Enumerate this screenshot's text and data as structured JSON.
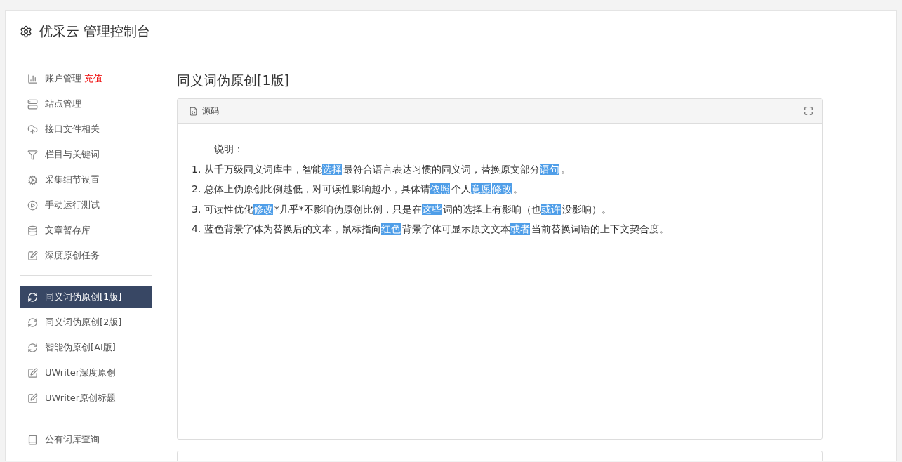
{
  "header": {
    "title": "优采云 管理控制台"
  },
  "sidebar": {
    "groups": [
      {
        "items": [
          {
            "label": "账户管理",
            "badge": "充值",
            "selected": false
          },
          {
            "label": "站点管理",
            "selected": false
          },
          {
            "label": "接口文件相关",
            "selected": false
          },
          {
            "label": "栏目与关键词",
            "selected": false
          },
          {
            "label": "采集细节设置",
            "selected": false
          },
          {
            "label": "手动运行测试",
            "selected": false
          },
          {
            "label": "文章暂存库",
            "selected": false
          },
          {
            "label": "深度原创任务",
            "selected": false
          }
        ]
      },
      {
        "items": [
          {
            "label": "同义词伪原创[1版]",
            "selected": true
          },
          {
            "label": "同义词伪原创[2版]",
            "selected": false
          },
          {
            "label": "智能伪原创[AI版]",
            "selected": false
          },
          {
            "label": "UWriter深度原创",
            "selected": false
          },
          {
            "label": "UWriter原创标题",
            "selected": false
          }
        ]
      },
      {
        "items": [
          {
            "label": "公有词库查询",
            "selected": false
          }
        ]
      }
    ]
  },
  "page_title": "同义词伪原创[1版]",
  "editor": {
    "tab": "源码",
    "heading": "说明：",
    "lines": [
      [
        {
          "text": "1. 从千万级同义词库中，智能",
          "highlighted": false
        },
        {
          "text": "选择",
          "highlighted": true
        },
        {
          "text": "最符合语言表达习惯的同义词，替换原文部分",
          "highlighted": false
        },
        {
          "text": "语句",
          "highlighted": true
        },
        {
          "text": "。",
          "highlighted": false
        }
      ],
      [
        {
          "text": "2. 总体上伪原创比例越低，对可读性影响越小，具体请",
          "highlighted": false
        },
        {
          "text": "依照",
          "highlighted": true
        },
        {
          "text": "个人",
          "highlighted": false
        },
        {
          "text": "意愿",
          "highlighted": true
        },
        {
          "text": "修改",
          "highlighted": true
        },
        {
          "text": "。",
          "highlighted": false
        }
      ],
      [
        {
          "text": "3. 可读性优化",
          "highlighted": false
        },
        {
          "text": "修改",
          "highlighted": true
        },
        {
          "text": "*几乎*不影响伪原创比例，只是在",
          "highlighted": false
        },
        {
          "text": "这些",
          "highlighted": true
        },
        {
          "text": "词的选择上有影响（也",
          "highlighted": false
        },
        {
          "text": "或许",
          "highlighted": true
        },
        {
          "text": "没影响）。",
          "highlighted": false
        }
      ],
      [
        {
          "text": "4. 蓝色背景字体为替换后的文本，鼠标指向",
          "highlighted": false
        },
        {
          "text": "红色",
          "highlighted": true
        },
        {
          "text": "背景字体可显示原文文本",
          "highlighted": false
        },
        {
          "text": "或者",
          "highlighted": true
        },
        {
          "text": "当前替换词语的上下文契合度。",
          "highlighted": false
        }
      ]
    ]
  }
}
